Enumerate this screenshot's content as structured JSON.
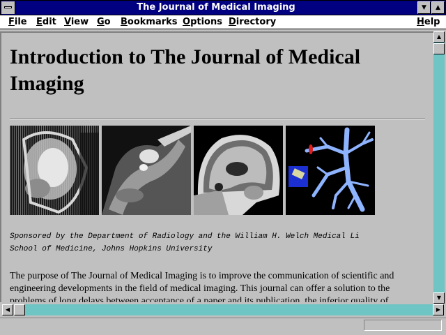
{
  "window": {
    "title": "The Journal of Medical Imaging",
    "minimize_glyph": "▼",
    "maximize_glyph": "▲"
  },
  "menu": {
    "items": [
      {
        "key": "F",
        "rest": "ile"
      },
      {
        "key": "E",
        "rest": "dit"
      },
      {
        "key": "V",
        "rest": "iew"
      },
      {
        "key": "G",
        "rest": "o"
      },
      {
        "key": "B",
        "rest": "ookmarks"
      },
      {
        "key": "O",
        "rest": "ptions"
      },
      {
        "key": "D",
        "rest": "irectory"
      },
      {
        "key": "H",
        "rest": "elp"
      }
    ]
  },
  "page": {
    "heading": "Introduction to The Journal of Medical Imaging",
    "images": [
      {
        "name": "cardiac-mri-image"
      },
      {
        "name": "abdominal-scan-image"
      },
      {
        "name": "brain-mri-image"
      },
      {
        "name": "vascular-3d-render-image"
      }
    ],
    "sponsor_line1": "Sponsored by the Department of Radiology and the William H. Welch Medical Li",
    "sponsor_line2": "School of Medicine, Johns Hopkins University",
    "paragraph": "The purpose of The Journal of Medical Imaging is to improve the communication of scientific and engineering developments in the field of medical imaging. This journal can offer a solution to the problems of long delays between acceptance of a paper and its publication, the inferior quality of"
  },
  "scroll": {
    "up_glyph": "▲",
    "down_glyph": "▼",
    "left_glyph": "◀",
    "right_glyph": "▶"
  },
  "colors": {
    "titlebar": "#000080",
    "scroll_track": "#6fc4c4",
    "window_bg": "#c0c0c0"
  }
}
